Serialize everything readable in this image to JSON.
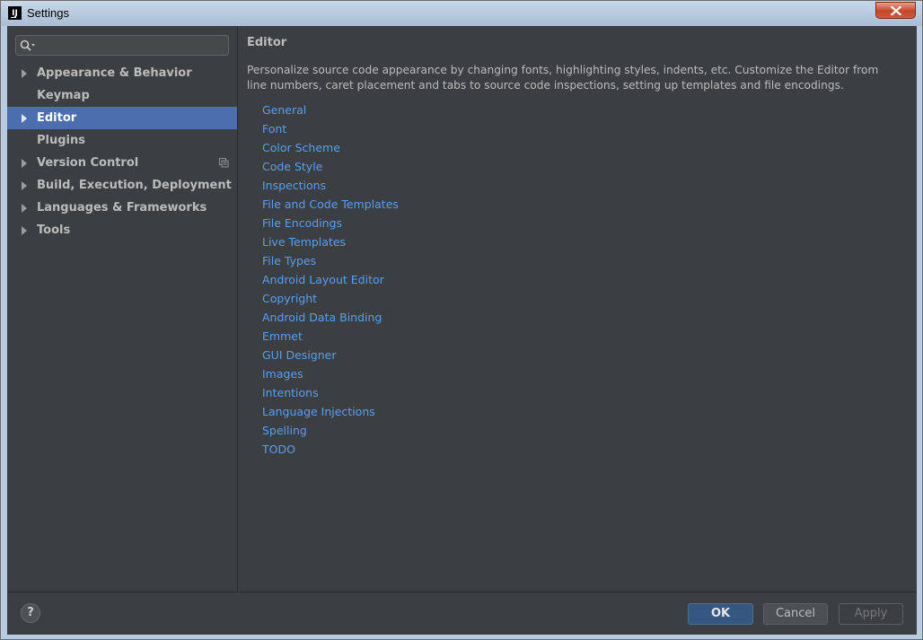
{
  "window": {
    "title": "Settings",
    "app_icon_text": "IJ"
  },
  "search": {
    "value": "",
    "placeholder": ""
  },
  "sidebar": {
    "items": [
      {
        "label": "Appearance & Behavior",
        "expandable": true,
        "selected": false
      },
      {
        "label": "Keymap",
        "expandable": false,
        "selected": false
      },
      {
        "label": "Editor",
        "expandable": true,
        "selected": true
      },
      {
        "label": "Plugins",
        "expandable": false,
        "selected": false
      },
      {
        "label": "Version Control",
        "expandable": true,
        "selected": false,
        "icon": "copy-icon"
      },
      {
        "label": "Build, Execution, Deployment",
        "expandable": true,
        "selected": false
      },
      {
        "label": "Languages & Frameworks",
        "expandable": true,
        "selected": false
      },
      {
        "label": "Tools",
        "expandable": true,
        "selected": false
      }
    ]
  },
  "main": {
    "title": "Editor",
    "description": "Personalize source code appearance by changing fonts, highlighting styles, indents, etc. Customize the Editor from line numbers, caret placement and tabs to source code inspections, setting up templates and file encodings.",
    "links": [
      "General",
      "Font",
      "Color Scheme",
      "Code Style",
      "Inspections",
      "File and Code Templates",
      "File Encodings",
      "Live Templates",
      "File Types",
      "Android Layout Editor",
      "Copyright",
      "Android Data Binding",
      "Emmet",
      "GUI Designer",
      "Images",
      "Intentions",
      "Language Injections",
      "Spelling",
      "TODO"
    ]
  },
  "footer": {
    "help_label": "?",
    "ok_label": "OK",
    "cancel_label": "Cancel",
    "apply_label": "Apply"
  },
  "colors": {
    "background": "#3c3f41",
    "selection": "#4b6eaf",
    "link": "#589df6",
    "text": "#bbbbbb",
    "ok_button": "#365880"
  }
}
